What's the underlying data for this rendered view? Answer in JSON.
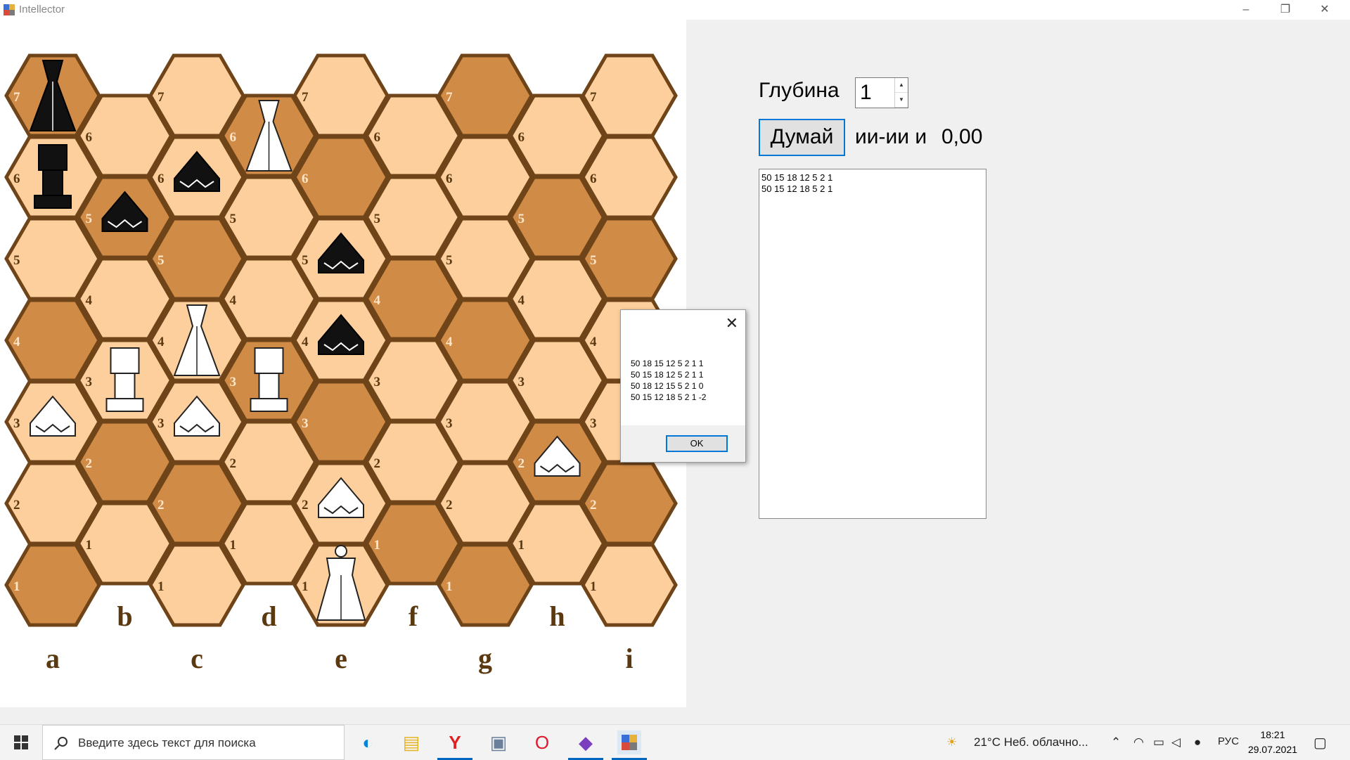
{
  "window": {
    "title": "Intellector"
  },
  "board": {
    "files": [
      "a",
      "b",
      "c",
      "d",
      "e",
      "f",
      "g",
      "h",
      "i"
    ],
    "tile_colors": {
      "light": "#fdcf9c",
      "dark": "#d08b47",
      "border": "#6e4418"
    },
    "ranks_long": [
      "7",
      "6",
      "5",
      "4",
      "3",
      "2",
      "1"
    ],
    "ranks_short": [
      "6",
      "5",
      "4",
      "3",
      "2",
      "1"
    ],
    "pieces": [
      {
        "file": "a",
        "rank": "7",
        "color": "black",
        "type": "agressor"
      },
      {
        "file": "a",
        "rank": "6",
        "color": "black",
        "type": "liberator"
      },
      {
        "file": "b",
        "rank": "5",
        "color": "black",
        "type": "progressor"
      },
      {
        "file": "c",
        "rank": "6",
        "color": "black",
        "type": "progressor"
      },
      {
        "file": "d",
        "rank": "6",
        "color": "white",
        "type": "agressor"
      },
      {
        "file": "e",
        "rank": "5",
        "color": "black",
        "type": "progressor"
      },
      {
        "file": "e",
        "rank": "4",
        "color": "black",
        "type": "progressor"
      },
      {
        "file": "c",
        "rank": "4",
        "color": "white",
        "type": "agressor"
      },
      {
        "file": "b",
        "rank": "3",
        "color": "white",
        "type": "liberator"
      },
      {
        "file": "d",
        "rank": "3",
        "color": "white",
        "type": "liberator"
      },
      {
        "file": "a",
        "rank": "3",
        "color": "white",
        "type": "progressor"
      },
      {
        "file": "c",
        "rank": "3",
        "color": "white",
        "type": "progressor"
      },
      {
        "file": "e",
        "rank": "2",
        "color": "white",
        "type": "progressor"
      },
      {
        "file": "h",
        "rank": "2",
        "color": "white",
        "type": "progressor"
      },
      {
        "file": "e",
        "rank": "1",
        "color": "white",
        "type": "intellector"
      }
    ]
  },
  "panel": {
    "depth_label": "Глубина",
    "depth_value": "1",
    "think_button": "Думай",
    "status_text": "ии-ии и",
    "score": "0,00",
    "log_lines": [
      "50 15 18 12 5 2 1",
      "50 15 12 18 5 2 1"
    ]
  },
  "dialog": {
    "lines": [
      "50 18 15 12 5 2 1 1",
      "50 15 18 12 5 2 1 1",
      "50 18 12 15 5 2 1 0",
      "50 15 12 18 5 2 1 -2"
    ],
    "ok_label": "OK"
  },
  "taskbar": {
    "search_placeholder": "Введите здесь текст для поиска",
    "weather": "21°C  Неб. облачно...",
    "language": "РУС",
    "time": "18:21",
    "date": "29.07.2021"
  }
}
